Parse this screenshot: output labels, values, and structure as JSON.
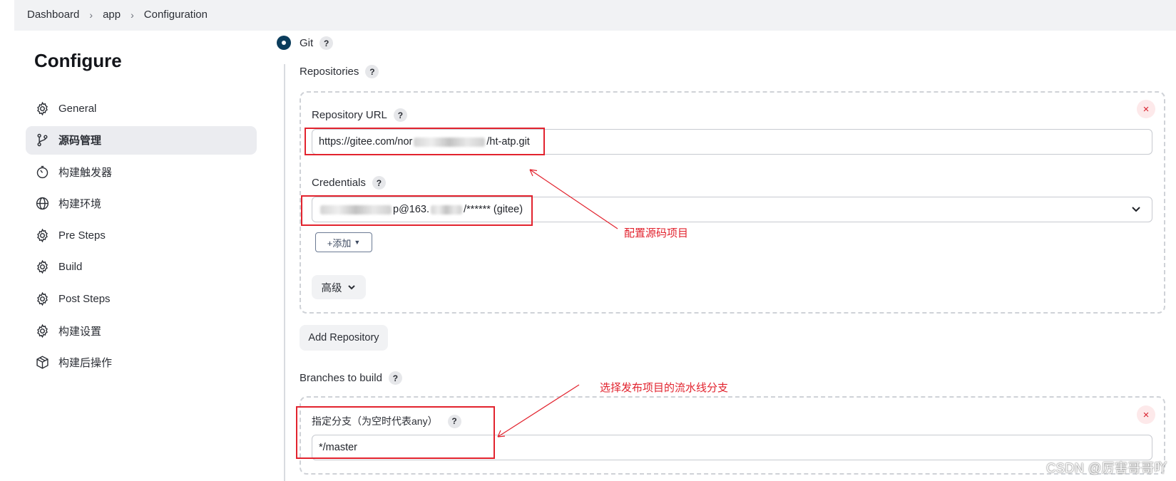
{
  "breadcrumb": [
    "Dashboard",
    "app",
    "Configuration"
  ],
  "page_title": "Configure",
  "sidebar": {
    "items": [
      {
        "label": "General",
        "icon": "gear-icon"
      },
      {
        "label": "源码管理",
        "icon": "branch-icon",
        "active": true
      },
      {
        "label": "构建触发器",
        "icon": "timer-icon"
      },
      {
        "label": "构建环境",
        "icon": "globe-icon"
      },
      {
        "label": "Pre Steps",
        "icon": "gear-icon"
      },
      {
        "label": "Build",
        "icon": "gear-icon"
      },
      {
        "label": "Post Steps",
        "icon": "gear-icon"
      },
      {
        "label": "构建设置",
        "icon": "gear-icon"
      },
      {
        "label": "构建后操作",
        "icon": "package-icon"
      }
    ]
  },
  "scm": {
    "option_label": "Git",
    "repositories_label": "Repositories",
    "repository_url_label": "Repository URL",
    "repository_url_prefix": "https://gitee.com/nor",
    "repository_url_suffix": "/ht-atp.git",
    "credentials_label": "Credentials",
    "credentials_mid": "p@163.",
    "credentials_suffix": "/****** (gitee)",
    "add_label": "+添加",
    "advanced_label": "高级",
    "add_repository_label": "Add Repository",
    "branches_label": "Branches to build",
    "branch_specifier_label": "指定分支（为空时代表any）",
    "branch_value": "*/master",
    "help_symbol": "?",
    "remove_symbol": "×"
  },
  "annotations": {
    "repo_note": "配置源码项目",
    "branch_note": "选择发布项目的流水线分支"
  },
  "watermark": "CSDN @厉害哥哥吖",
  "colors": {
    "accent": "#0b3d5c",
    "annotation": "#e2232e",
    "active_nav_bg": "#ebecf0",
    "remove_red": "#d8202c"
  }
}
